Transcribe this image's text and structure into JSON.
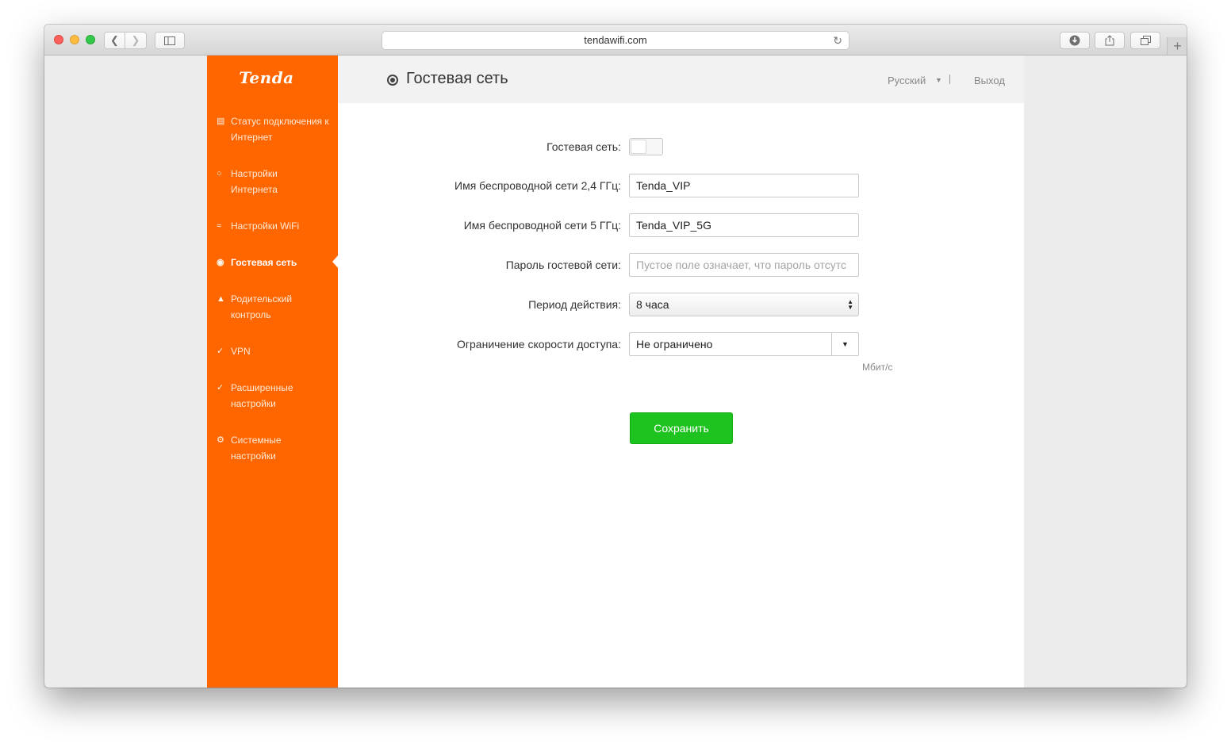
{
  "browser": {
    "url": "tendawifi.com"
  },
  "sidebar": {
    "logo": "Tenda",
    "items": [
      {
        "label_line1": "Статус подключения к",
        "label_line2": "Интернет",
        "icon": "router-status-icon"
      },
      {
        "label_line1": "Настройки",
        "label_line2": "Интернета",
        "icon": "globe-icon"
      },
      {
        "label_line1": "Настройки WiFi",
        "label_line2": "",
        "icon": "wifi-icon"
      },
      {
        "label_line1": "Гостевая сеть",
        "label_line2": "",
        "icon": "guest-network-icon",
        "active": true
      },
      {
        "label_line1": "Родительский",
        "label_line2": "контроль",
        "icon": "parental-control-icon"
      },
      {
        "label_line1": "VPN",
        "label_line2": "",
        "icon": "vpn-icon"
      },
      {
        "label_line1": "Расширенные",
        "label_line2": "настройки",
        "icon": "tools-icon"
      },
      {
        "label_line1": "Системные",
        "label_line2": "настройки",
        "icon": "gear-icon"
      }
    ]
  },
  "header": {
    "title": "Гостевая сеть",
    "language": "Русский",
    "logout": "Выход"
  },
  "form": {
    "guest_label": "Гостевая сеть:",
    "guest_enabled": false,
    "ssid24_label": "Имя беспроводной сети 2,4 ГГц:",
    "ssid24_value": "Tenda_VIP",
    "ssid5_label": "Имя беспроводной сети 5 ГГц:",
    "ssid5_value": "Tenda_VIP_5G",
    "password_label": "Пароль гостевой сети:",
    "password_placeholder": "Пустое поле означает, что пароль отсутс",
    "period_label": "Период действия:",
    "period_value": "8 часа",
    "speed_label": "Ограничение скорости доступа:",
    "speed_value": "Не ограничено",
    "speed_unit": "Мбит/с",
    "save_label": "Сохранить"
  },
  "colors": {
    "sidebar_bg": "#ff6600",
    "save_button": "#1fc31f"
  }
}
